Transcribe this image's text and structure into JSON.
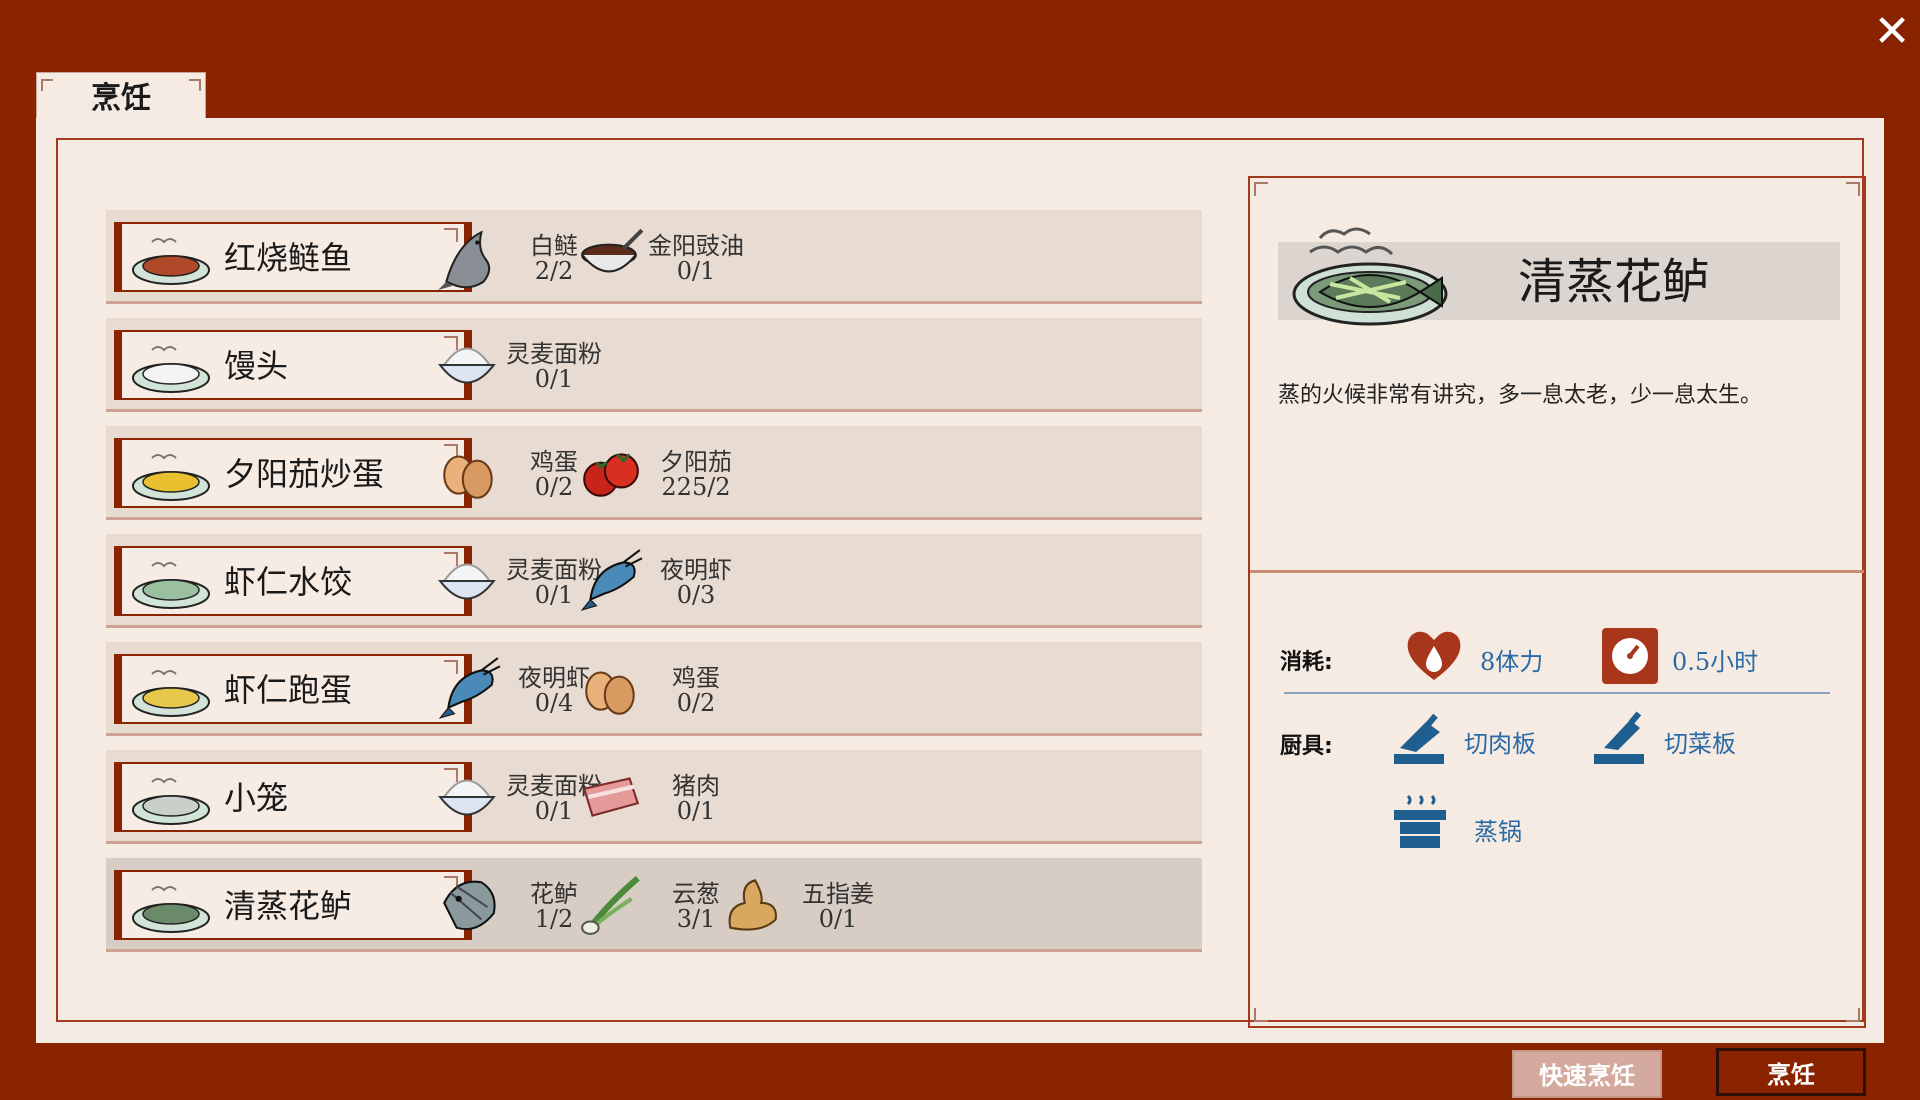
{
  "tab": {
    "label": "烹饪"
  },
  "recipes": [
    {
      "name": "红烧鲢鱼",
      "dish_icon": "braised-fish-dish-icon",
      "ingredients": [
        {
          "name": "白鲢",
          "count": "2/2",
          "icon": "fish-icon"
        },
        {
          "name": "金阳豉油",
          "count": "0/1",
          "icon": "soy-sauce-bowl-icon"
        }
      ]
    },
    {
      "name": "馒头",
      "dish_icon": "steamed-bun-dish-icon",
      "ingredients": [
        {
          "name": "灵麦面粉",
          "count": "0/1",
          "icon": "flour-bowl-icon"
        }
      ]
    },
    {
      "name": "夕阳茄炒蛋",
      "dish_icon": "tomato-egg-dish-icon",
      "ingredients": [
        {
          "name": "鸡蛋",
          "count": "0/2",
          "icon": "egg-icon"
        },
        {
          "name": "夕阳茄",
          "count": "225/2",
          "icon": "tomato-icon"
        }
      ]
    },
    {
      "name": "虾仁水饺",
      "dish_icon": "shrimp-dumpling-dish-icon",
      "ingredients": [
        {
          "name": "灵麦面粉",
          "count": "0/1",
          "icon": "flour-bowl-icon"
        },
        {
          "name": "夜明虾",
          "count": "0/3",
          "icon": "shrimp-icon"
        }
      ]
    },
    {
      "name": "虾仁跑蛋",
      "dish_icon": "shrimp-omelette-dish-icon",
      "ingredients": [
        {
          "name": "夜明虾",
          "count": "0/4",
          "icon": "shrimp-icon"
        },
        {
          "name": "鸡蛋",
          "count": "0/2",
          "icon": "egg-icon"
        }
      ]
    },
    {
      "name": "小笼",
      "dish_icon": "xiaolong-dish-icon",
      "ingredients": [
        {
          "name": "灵麦面粉",
          "count": "0/1",
          "icon": "flour-bowl-icon"
        },
        {
          "name": "猪肉",
          "count": "0/1",
          "icon": "pork-icon"
        }
      ]
    },
    {
      "name": "清蒸花鲈",
      "dish_icon": "steamed-bass-dish-icon",
      "selected": true,
      "ingredients": [
        {
          "name": "花鲈",
          "count": "1/2",
          "icon": "bass-fish-icon"
        },
        {
          "name": "云葱",
          "count": "3/1",
          "icon": "scallion-icon"
        },
        {
          "name": "五指姜",
          "count": "0/1",
          "icon": "ginger-icon"
        }
      ]
    }
  ],
  "detail": {
    "title": "清蒸花鲈",
    "description": "蒸的火候非常有讲究，多一息太老，少一息太生。",
    "cost_label": "消耗:",
    "stamina": "8体力",
    "time": "0.5小时",
    "tools_label": "厨具:",
    "tools": [
      "切肉板",
      "切菜板",
      "蒸锅"
    ]
  },
  "buttons": {
    "quick": "快速烹饪",
    "cook": "烹饪"
  },
  "colors": {
    "frame": "#8a2300",
    "paper": "#f6ebe2",
    "accent_blue": "#2a6aa6",
    "row_bg": "#e8dcd2"
  }
}
